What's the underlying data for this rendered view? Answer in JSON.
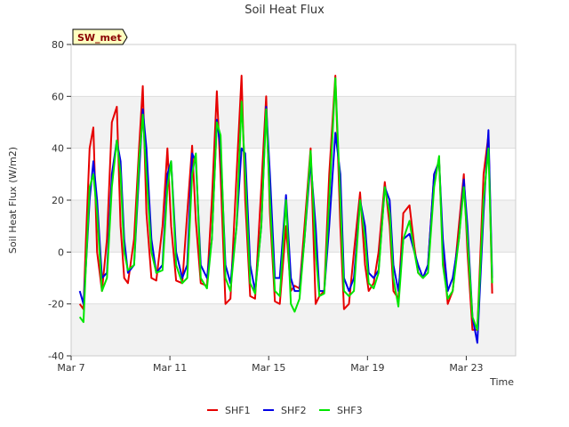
{
  "chart_data": {
    "type": "line",
    "title": "Soil Heat Flux",
    "xlabel": "Time",
    "ylabel": "Soil Heat Flux (W/m2)",
    "ylim": [
      -40,
      80
    ],
    "yticks": [
      -40,
      -20,
      0,
      20,
      40,
      60,
      80
    ],
    "xlim": [
      7.0,
      25.0
    ],
    "xticks": [
      {
        "value": 7,
        "label": "Mar 7"
      },
      {
        "value": 11,
        "label": "Mar 11"
      },
      {
        "value": 15,
        "label": "Mar 15"
      },
      {
        "value": 19,
        "label": "Mar 19"
      },
      {
        "value": 23,
        "label": "Mar 23"
      }
    ],
    "badge": "SW_met",
    "legend_position": "bottom-center",
    "grid": true,
    "series": [
      {
        "name": "SHF1",
        "color": "#e60000",
        "x": [
          7.35,
          7.5,
          7.6,
          7.75,
          7.9,
          8.05,
          8.25,
          8.45,
          8.65,
          8.85,
          9.0,
          9.15,
          9.3,
          9.55,
          9.75,
          9.9,
          10.05,
          10.25,
          10.45,
          10.7,
          10.9,
          11.05,
          11.25,
          11.5,
          11.7,
          11.9,
          12.05,
          12.25,
          12.5,
          12.7,
          12.9,
          13.05,
          13.25,
          13.45,
          13.7,
          13.9,
          14.05,
          14.25,
          14.45,
          14.7,
          14.9,
          15.05,
          15.25,
          15.45,
          15.7,
          15.9,
          16.05,
          16.25,
          16.45,
          16.7,
          16.9,
          17.05,
          17.25,
          17.45,
          17.7,
          17.9,
          18.05,
          18.25,
          18.45,
          18.7,
          18.9,
          19.05,
          19.25,
          19.45,
          19.7,
          19.9,
          20.05,
          20.25,
          20.45,
          20.7,
          20.9,
          21.05,
          21.25,
          21.45,
          21.7,
          21.9,
          22.05,
          22.25,
          22.45,
          22.7,
          22.9,
          23.05,
          23.25,
          23.45,
          23.7,
          23.9,
          24.05
        ],
        "y": [
          -20,
          -22,
          5,
          40,
          48,
          0,
          -15,
          5,
          50,
          56,
          10,
          -10,
          -12,
          5,
          40,
          64,
          15,
          -10,
          -11,
          10,
          40,
          10,
          -11,
          -12,
          15,
          41,
          12,
          -12,
          -13,
          20,
          62,
          30,
          -20,
          -18,
          30,
          68,
          20,
          -17,
          -18,
          25,
          60,
          15,
          -19,
          -20,
          10,
          -15,
          -13,
          -14,
          10,
          40,
          -20,
          -17,
          -15,
          30,
          68,
          10,
          -22,
          -20,
          0,
          23,
          -5,
          -15,
          -12,
          0,
          27,
          10,
          -15,
          -18,
          15,
          18,
          2,
          -8,
          -10,
          -5,
          30,
          35,
          0,
          -20,
          -15,
          10,
          30,
          0,
          -30,
          -30,
          30,
          45,
          -16
        ]
      },
      {
        "name": "SHF2",
        "color": "#0000e6",
        "x": [
          7.35,
          7.5,
          7.6,
          7.75,
          7.9,
          8.05,
          8.25,
          8.45,
          8.65,
          8.85,
          9.0,
          9.15,
          9.3,
          9.55,
          9.75,
          9.9,
          10.05,
          10.25,
          10.45,
          10.7,
          10.9,
          11.05,
          11.25,
          11.5,
          11.7,
          11.9,
          12.05,
          12.25,
          12.5,
          12.7,
          12.9,
          13.05,
          13.25,
          13.45,
          13.7,
          13.9,
          14.05,
          14.25,
          14.45,
          14.7,
          14.9,
          15.05,
          15.25,
          15.45,
          15.7,
          15.9,
          16.05,
          16.25,
          16.45,
          16.7,
          16.9,
          17.05,
          17.25,
          17.45,
          17.7,
          17.9,
          18.05,
          18.25,
          18.45,
          18.7,
          18.9,
          19.05,
          19.25,
          19.45,
          19.7,
          19.9,
          20.05,
          20.25,
          20.45,
          20.7,
          20.9,
          21.05,
          21.25,
          21.45,
          21.7,
          21.9,
          22.05,
          22.25,
          22.45,
          22.7,
          22.9,
          23.05,
          23.25,
          23.45,
          23.7,
          23.9,
          24.05
        ],
        "y": [
          -15,
          -20,
          -5,
          20,
          35,
          20,
          -10,
          -8,
          30,
          43,
          35,
          5,
          -8,
          -5,
          30,
          55,
          40,
          5,
          -8,
          -5,
          30,
          35,
          0,
          -10,
          -5,
          38,
          35,
          -5,
          -10,
          5,
          51,
          40,
          -5,
          -12,
          10,
          40,
          38,
          -5,
          -15,
          10,
          56,
          30,
          -10,
          -10,
          22,
          -10,
          -15,
          -15,
          5,
          35,
          10,
          -15,
          -15,
          10,
          46,
          30,
          -10,
          -15,
          -10,
          20,
          10,
          -8,
          -10,
          -7,
          25,
          20,
          -5,
          -15,
          5,
          7,
          0,
          -5,
          -10,
          -5,
          30,
          35,
          5,
          -15,
          -10,
          5,
          28,
          10,
          -25,
          -35,
          15,
          47,
          -10
        ]
      },
      {
        "name": "SHF3",
        "color": "#00e600",
        "x": [
          7.35,
          7.5,
          7.6,
          7.75,
          7.9,
          8.05,
          8.25,
          8.45,
          8.65,
          8.85,
          9.0,
          9.15,
          9.3,
          9.55,
          9.75,
          9.9,
          10.05,
          10.25,
          10.45,
          10.7,
          10.9,
          11.05,
          11.25,
          11.5,
          11.7,
          11.9,
          12.05,
          12.25,
          12.5,
          12.7,
          12.9,
          13.05,
          13.25,
          13.45,
          13.7,
          13.9,
          14.05,
          14.25,
          14.45,
          14.7,
          14.9,
          15.05,
          15.25,
          15.45,
          15.7,
          15.9,
          16.05,
          16.25,
          16.45,
          16.7,
          16.9,
          17.05,
          17.25,
          17.45,
          17.7,
          17.9,
          18.05,
          18.25,
          18.45,
          18.7,
          18.9,
          19.05,
          19.25,
          19.45,
          19.7,
          19.9,
          20.05,
          20.25,
          20.45,
          20.7,
          20.9,
          21.05,
          21.25,
          21.45,
          21.7,
          21.9,
          22.05,
          22.25,
          22.45,
          22.7,
          22.9,
          23.05,
          23.25,
          23.45,
          23.7,
          23.9,
          24.05
        ],
        "y": [
          -25,
          -27,
          -5,
          25,
          30,
          15,
          -15,
          -10,
          25,
          43,
          30,
          0,
          -7,
          -5,
          35,
          53,
          30,
          0,
          -8,
          -7,
          25,
          35,
          -5,
          -12,
          -10,
          30,
          38,
          -10,
          -14,
          5,
          50,
          45,
          -10,
          -15,
          10,
          58,
          30,
          -12,
          -16,
          10,
          55,
          20,
          -15,
          -17,
          20,
          -20,
          -23,
          -18,
          5,
          39,
          0,
          -17,
          -16,
          20,
          67,
          20,
          -15,
          -17,
          -15,
          20,
          5,
          -12,
          -14,
          -8,
          25,
          15,
          -10,
          -21,
          5,
          12,
          0,
          -8,
          -10,
          -8,
          25,
          37,
          -5,
          -18,
          -15,
          5,
          25,
          5,
          -25,
          -30,
          20,
          40,
          -12
        ]
      }
    ]
  }
}
